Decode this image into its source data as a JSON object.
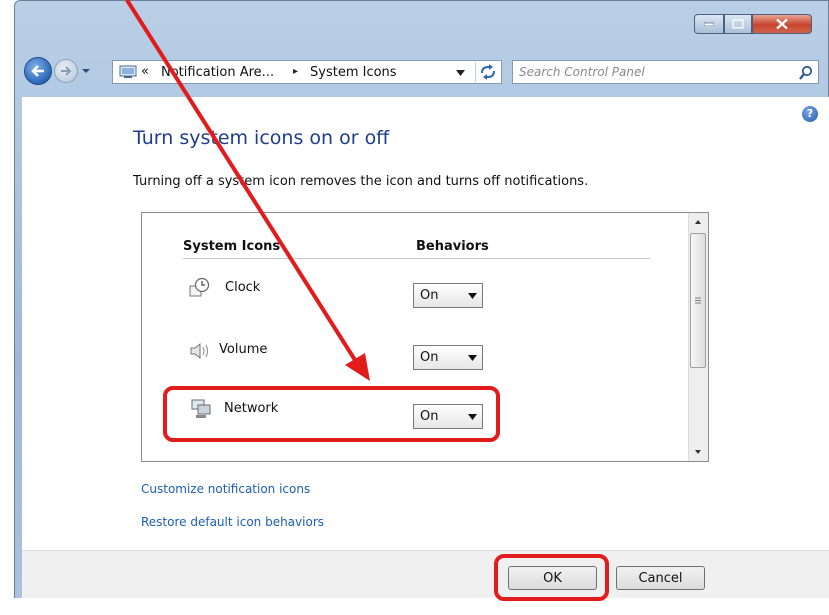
{
  "window": {
    "address": {
      "crumbs": [
        "« ",
        "Notification Are...",
        "System Icons"
      ],
      "separator": "▸"
    },
    "search": {
      "placeholder": "Search Control Panel"
    },
    "help": "?"
  },
  "main": {
    "title": "Turn system icons on or off",
    "description": "Turning off a system icon removes the icon and turns off notifications.",
    "table": {
      "columns": [
        "System Icons",
        "Behaviors"
      ],
      "rows": [
        {
          "label": "Clock",
          "icon": "clock-icon",
          "behavior": "On"
        },
        {
          "label": "Volume",
          "icon": "volume-icon",
          "behavior": "On"
        },
        {
          "label": "Network",
          "icon": "network-icon",
          "behavior": "On"
        }
      ]
    },
    "links": [
      "Customize notification icons",
      "Restore default icon behaviors"
    ]
  },
  "footer": {
    "ok_label": "OK",
    "cancel_label": "Cancel"
  },
  "annotations": {
    "color": "#e21b1b",
    "highlights": [
      "network-row",
      "ok-button"
    ]
  },
  "colors": {
    "title": "#1e3d8c",
    "link": "#1c5fb0",
    "frame": "#9db9d8"
  }
}
